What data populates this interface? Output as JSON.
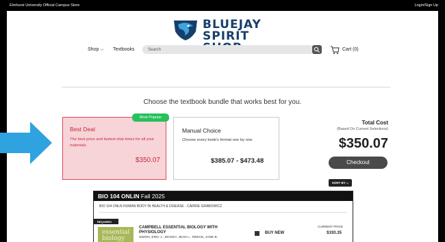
{
  "topbar": {
    "store_name": "Elmhurst University Official Campus Store",
    "login": "Login/Sign Up"
  },
  "logo": {
    "line1": "BLUEJAY",
    "line2": "SPIRIT SHOP"
  },
  "nav": {
    "shop": "Shop ⌵",
    "textbooks": "Textbooks",
    "search_placeholder": "Search",
    "cart": "Cart (0)"
  },
  "heading": "Choose the textbook bundle that works best for you.",
  "best_deal": {
    "badge": "Most Popular",
    "title": "Best Deal",
    "description": "The best price and fastest ship times for all your materials.",
    "price": "$350.07"
  },
  "manual_choice": {
    "title": "Manual Choice",
    "description": "Choose every book's format one by one.",
    "price": "$385.07 - $473.48"
  },
  "total": {
    "label": "Total Cost",
    "sublabel": "(Based On Current Selections)",
    "price": "$350.07",
    "checkout": "Checkout",
    "sort_by": "SORT BY ⌵"
  },
  "course": {
    "code": "BIO 104 ONLIN",
    "term": "Fall 2025",
    "subtitle": "BIO 104 ONLN HUMAN BODY IN HEALTH & DISEASE - CARRIE GRABOWICZ",
    "required": "REQUIRED",
    "book": {
      "cover_text": "essential biology",
      "title": "CAMPBELL ESSENTIAL BIOLOGY WITH PHYSIOLOGY",
      "authors": "SIMON, ERIC J.; DICKEY, JEAN L.; REECE, JANE B.",
      "buy_option": "BUY NEW",
      "current_price_label": "CURRENT PRICE",
      "current_price": "$193.35"
    }
  },
  "colors": {
    "brand_navy": "#173f6b",
    "best_red": "#c8283c",
    "badge_green": "#25c15a",
    "arrow_blue": "#2fa3e0"
  }
}
